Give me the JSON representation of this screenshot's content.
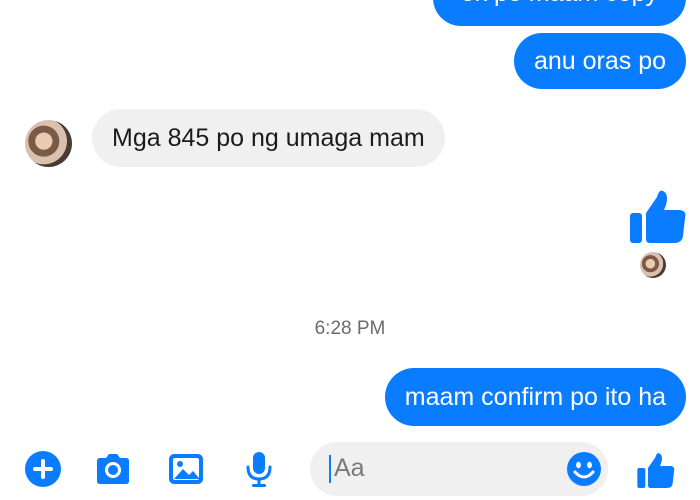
{
  "conversation": {
    "messages": [
      {
        "sender": "me",
        "text": "ok po maam copy"
      },
      {
        "sender": "me",
        "text": "anu oras po"
      },
      {
        "sender": "contact",
        "text": "Mga 845 po ng umaga mam"
      },
      {
        "sender": "me",
        "text": "thumbs-up-icon"
      },
      {
        "sender": "me",
        "text": "maam confirm po ito ha"
      }
    ],
    "timestamp": "6:28 PM"
  },
  "composer": {
    "placeholder": "Aa",
    "icons": [
      "plus-icon",
      "camera-icon",
      "photo-icon",
      "microphone-icon",
      "emoji-icon",
      "thumbs-up-icon"
    ]
  },
  "colors": {
    "accent": "#0a7cff",
    "incoming_bubble": "#f0f0f0",
    "timestamp": "#6b6b6b"
  }
}
